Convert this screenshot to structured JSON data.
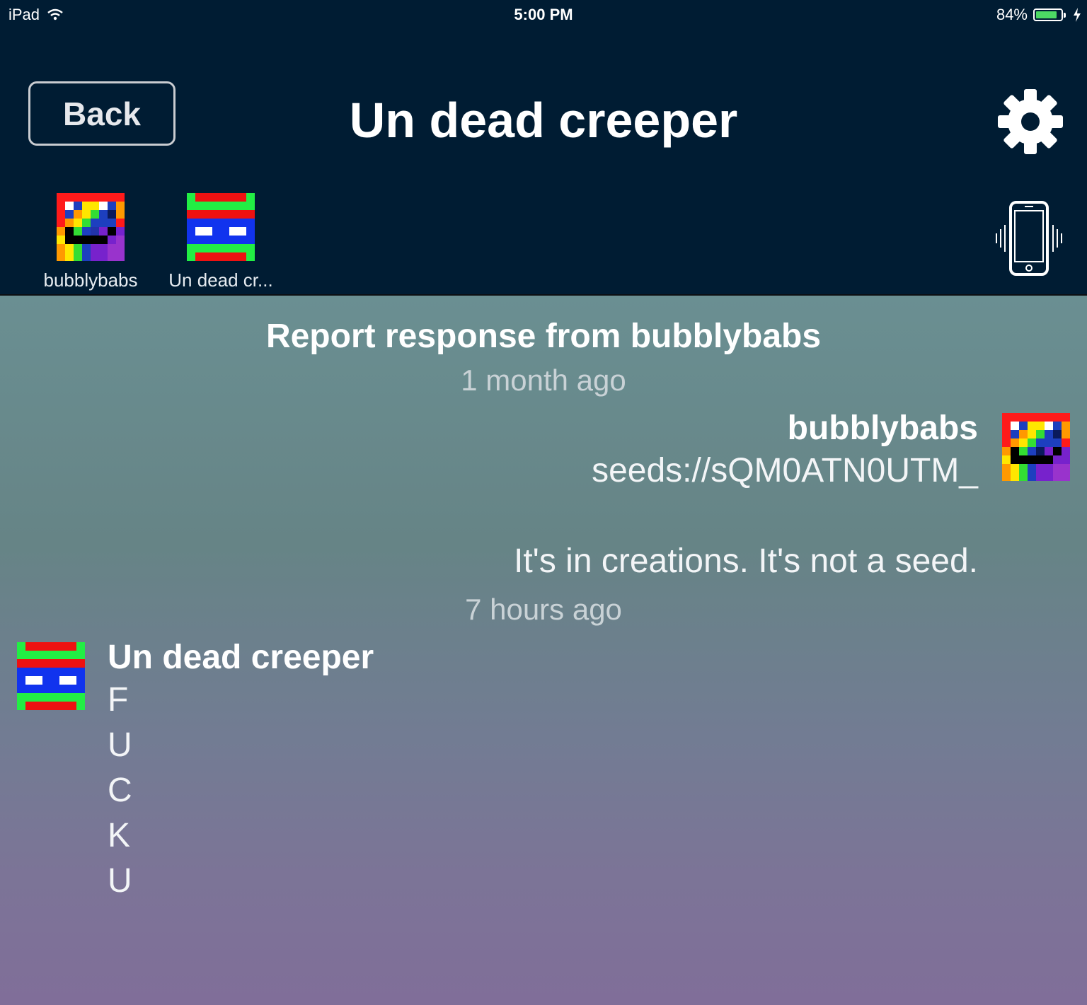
{
  "status_bar": {
    "device": "iPad",
    "time": "5:00 PM",
    "battery_percent": "84%",
    "battery_level": 0.84
  },
  "nav": {
    "back_label": "Back",
    "title": "Un dead creeper"
  },
  "participants": [
    {
      "name": "bubblybabs"
    },
    {
      "name": "Un dead cr..."
    }
  ],
  "conversation": {
    "title": "Report response from bubblybabs",
    "timestamp_1": "1 month ago",
    "message_1": {
      "sender": "bubblybabs",
      "lines": [
        "seeds://sQM0ATN0UTM_",
        "",
        "It's in creations. It's not a seed."
      ]
    },
    "timestamp_2": "7 hours ago",
    "message_2": {
      "sender": "Un dead creeper",
      "lines": [
        "F",
        "U",
        "C",
        "K",
        "U"
      ]
    }
  },
  "colors": {
    "nav_background": "#001c33",
    "battery_fill": "#4cd964"
  }
}
